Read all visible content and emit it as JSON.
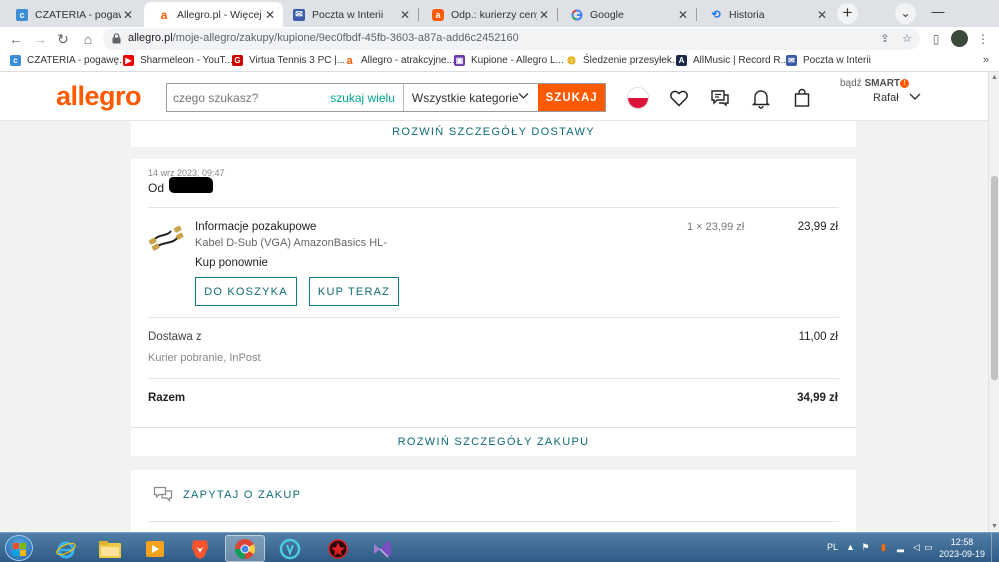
{
  "browser": {
    "tabs": [
      {
        "title": "CZATERIA - pogawędki",
        "favicon": "czateria-icon",
        "active": false
      },
      {
        "title": "Allegro.pl - Więcej niż aukcje",
        "favicon": "allegro-icon",
        "active": true
      },
      {
        "title": "Poczta w Interii",
        "favicon": "mail-icon",
        "active": false
      },
      {
        "title": "Odp.: kurierzy ceny pobrania",
        "favicon": "allegro-icon",
        "active": false
      },
      {
        "title": "Google",
        "favicon": "google-icon",
        "active": false
      },
      {
        "title": "Historia",
        "favicon": "history-icon",
        "active": false
      }
    ],
    "new_tab_symbol": "+",
    "url_host": "allegro.pl",
    "url_path": "/moje-allegro/zakupy/kupione/9ec0fbdf-45fb-3603-a87a-add6c2452160",
    "bookmarks": [
      {
        "label": "CZATERIA - pogawę...",
        "icon": "czateria-icon"
      },
      {
        "label": "Sharmeleon - YouT...",
        "icon": "youtube-icon"
      },
      {
        "label": "Virtua Tennis 3 PC |...",
        "icon": "g-icon"
      },
      {
        "label": "Allegro - atrakcyjne...",
        "icon": "allegro-icon"
      },
      {
        "label": "Kupione - Allegro L...",
        "icon": "bag-icon"
      },
      {
        "label": "Śledzenie przesyłek...",
        "icon": "bulb-icon"
      },
      {
        "label": "AllMusic | Record R...",
        "icon": "allmusic-icon"
      },
      {
        "label": "Poczta w Interii",
        "icon": "mail-icon"
      }
    ],
    "bookmarks_more": "»"
  },
  "allegro_header": {
    "logo": "allegro",
    "search_placeholder": "czego szukasz?",
    "search_many": "szukaj wielu",
    "category": "Wszystkie kategorie",
    "search_button": "SZUKAJ",
    "smart_prefix": "bądź",
    "smart_brand": "SMART",
    "smart_badge": "!",
    "user_name": "Rafał"
  },
  "order": {
    "expand_delivery": "ROZWIŃ SZCZEGÓŁY DOSTAWY",
    "date": "14 wrz 2023, 09:47",
    "from_label": "Od",
    "product_name": "Informacje pozakupowe",
    "product_desc": "Kabel D-Sub (VGA) AmazonBasics HL-",
    "quantity_price": "1 × 23,99 zł",
    "price": "23,99 zł",
    "rebuy_label": "Kup ponownie",
    "add_to_cart": "DO KOSZYKA",
    "buy_now": "KUP TERAZ",
    "shipping_label": "Dostawa z",
    "shipping_method": "Kurier pobranie, InPost",
    "shipping_price": "11,00 zł",
    "total_label": "Razem",
    "total_value": "34,99 zł",
    "expand_purchase": "ROZWIŃ SZCZEGÓŁY ZAKUPU",
    "ask_label": "ZAPYTAJ O ZAKUP"
  },
  "taskbar": {
    "language": "PL",
    "time": "12:58",
    "date": "2023-09-19"
  },
  "colors": {
    "allegro_orange": "#ff5a00",
    "teal": "#0e6a78",
    "search_many_green": "#00a790"
  }
}
